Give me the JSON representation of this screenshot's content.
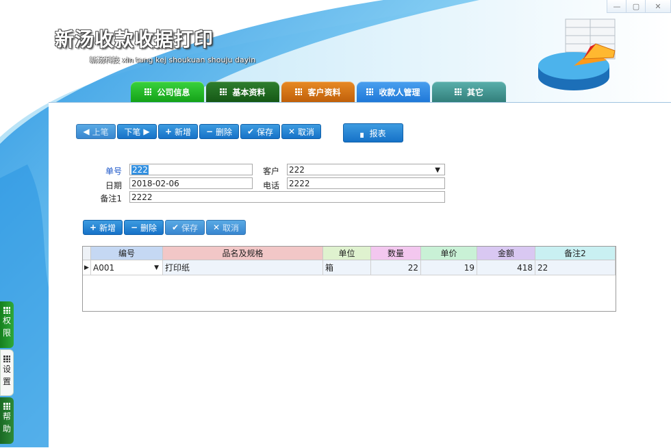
{
  "window": {
    "minimize": "—",
    "restore": "▢",
    "close": "✕"
  },
  "header": {
    "title": "新汤收款收据打印",
    "subtitle": "新汤科技 xin tang kej shoukuan shouju dayin"
  },
  "tabs": [
    {
      "label": "公司信息",
      "color": "#22b525"
    },
    {
      "label": "基本资料",
      "color": "#1f6e1f"
    },
    {
      "label": "客户资料",
      "color": "#d4710a"
    },
    {
      "label": "收款人管理",
      "color": "#2d86e0"
    },
    {
      "label": "其它",
      "color": "#3f9a96"
    }
  ],
  "toolbar": {
    "prev": "上笔",
    "next": "下笔",
    "add": "新增",
    "delete": "删除",
    "save": "保存",
    "cancel": "取消",
    "report": "报表"
  },
  "form": {
    "no_label": "单号",
    "no_value": "222",
    "date_label": "日期",
    "date_value": "2018-02-06",
    "remark_label": "备注1",
    "remark_value": "2222",
    "customer_label": "客户",
    "customer_value": "222",
    "phone_label": "电话",
    "phone_value": "2222"
  },
  "detail_toolbar": {
    "add": "新增",
    "delete": "删除",
    "save": "保存",
    "cancel": "取消"
  },
  "grid": {
    "columns": [
      "编号",
      "品名及规格",
      "单位",
      "数量",
      "单价",
      "金额",
      "备注2"
    ],
    "rows": [
      [
        "A001",
        "打印纸",
        "箱",
        "22",
        "19",
        "418",
        "22"
      ]
    ]
  },
  "sidebar": [
    {
      "label1": "权",
      "label2": "限",
      "color": "#1e8c2a"
    },
    {
      "label1": "设",
      "label2": "置",
      "color": "#ffffff"
    },
    {
      "label1": "帮",
      "label2": "助",
      "color": "#1e6e2a"
    }
  ]
}
